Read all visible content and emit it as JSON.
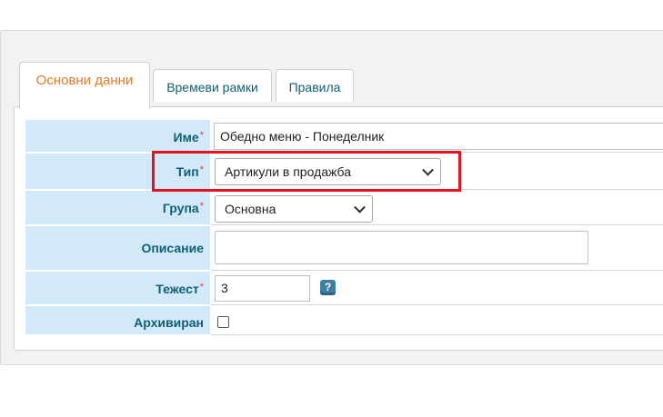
{
  "tabs": [
    {
      "label": "Основни данни",
      "active": true
    },
    {
      "label": "Времеви рамки",
      "active": false
    },
    {
      "label": "Правила",
      "active": false
    }
  ],
  "form": {
    "name": {
      "label": "Име",
      "required_mark": "*",
      "value": "Обедно меню  - Понеделник"
    },
    "type": {
      "label": "Тип",
      "required_mark": "*",
      "selected": "Артикули в продажба"
    },
    "group": {
      "label": "Група",
      "required_mark": "*",
      "selected": "Основна"
    },
    "description": {
      "label": "Описание",
      "value": ""
    },
    "weight": {
      "label": "Тежест",
      "required_mark": "*",
      "value": "3",
      "help_glyph": "?"
    },
    "archived": {
      "label": "Архивиран",
      "checked": false
    }
  },
  "colors": {
    "active_tab": "#e07a1f",
    "label_text": "#0f5f73",
    "label_bg": "#d2e9fa",
    "required": "#e0403a",
    "highlight": "#e8101a"
  }
}
